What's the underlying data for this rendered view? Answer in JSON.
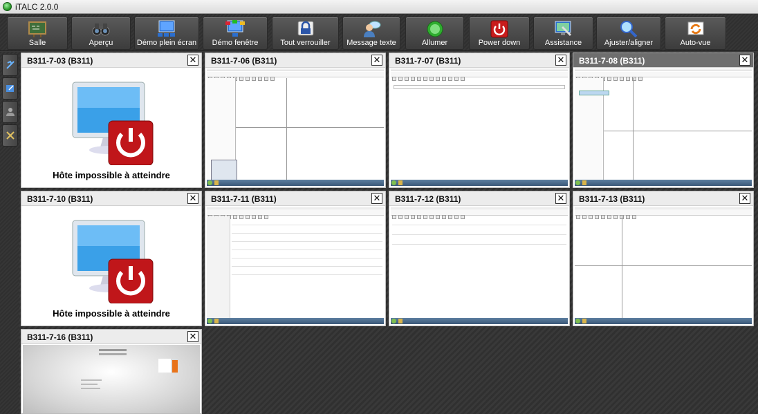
{
  "window": {
    "title": "iTALC 2.0.0"
  },
  "toolbar": {
    "buttons": [
      {
        "id": "salle",
        "label": "Salle",
        "icon": "chalkboard-icon"
      },
      {
        "id": "apercu",
        "label": "Aperçu",
        "icon": "binoculars-icon"
      },
      {
        "id": "demo_plein",
        "label": "Démo plein écran",
        "icon": "fullscreen-demo-icon"
      },
      {
        "id": "demo_fenetre",
        "label": "Démo fenêtre",
        "icon": "window-demo-icon"
      },
      {
        "id": "verrouiller",
        "label": "Tout verrouiller",
        "icon": "lock-icon"
      },
      {
        "id": "message",
        "label": "Message texte",
        "icon": "message-icon"
      },
      {
        "id": "allumer",
        "label": "Allumer",
        "icon": "power-on-icon"
      },
      {
        "id": "powerdown",
        "label": "Power down",
        "icon": "power-off-icon"
      },
      {
        "id": "assistance",
        "label": "Assistance",
        "icon": "remote-assist-icon"
      },
      {
        "id": "ajuster",
        "label": "Ajuster/aligner",
        "icon": "magnifier-icon"
      },
      {
        "id": "autovue",
        "label": "Auto-vue",
        "icon": "auto-view-icon"
      }
    ]
  },
  "sidebar": {
    "buttons": [
      {
        "icon": "classroom-icon"
      },
      {
        "icon": "snapshot-icon"
      },
      {
        "icon": "users-icon"
      },
      {
        "icon": "config-tools-icon"
      }
    ]
  },
  "tiles": [
    {
      "name": "B311-7-03 (B311)",
      "state": "offline",
      "status": "Hôte impossible à atteindre"
    },
    {
      "name": "B311-7-06 (B311)",
      "state": "graph"
    },
    {
      "name": "B311-7-07 (B311)",
      "state": "blank"
    },
    {
      "name": "B311-7-08 (B311)",
      "state": "graph",
      "active": true
    },
    {
      "name": "B311-7-10 (B311)",
      "state": "offline",
      "status": "Hôte impossible à atteindre"
    },
    {
      "name": "B311-7-11 (B311)",
      "state": "list"
    },
    {
      "name": "B311-7-12 (B311)",
      "state": "list-short"
    },
    {
      "name": "B311-7-13 (B311)",
      "state": "graph"
    },
    {
      "name": "B311-7-16 (B311)",
      "state": "desktop"
    }
  ],
  "close_glyph": "✕",
  "colors": {
    "offline_red": "#c0161a",
    "toolbar_bg": "#333333",
    "active_header": "#6e6e6e"
  }
}
